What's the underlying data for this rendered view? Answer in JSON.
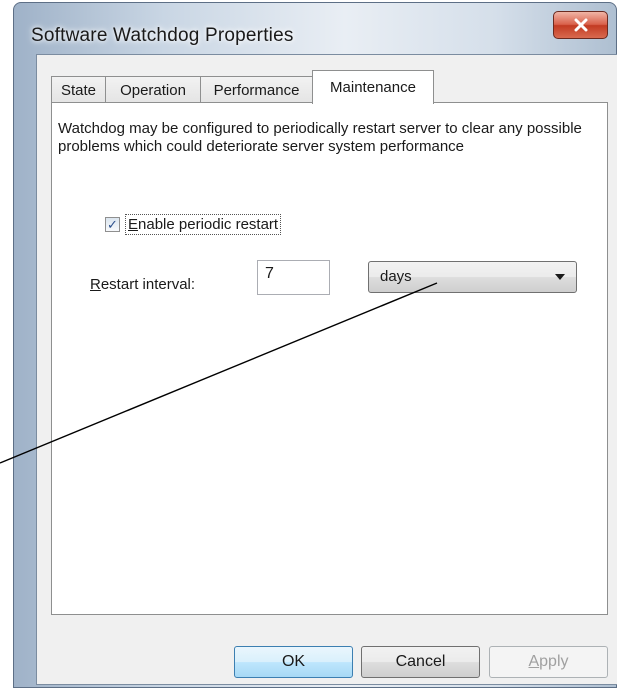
{
  "window": {
    "title": "Software Watchdog Properties",
    "close_glyph": "X"
  },
  "tabs": [
    {
      "label": "State",
      "active": false
    },
    {
      "label": "Operation",
      "active": false
    },
    {
      "label": "Performance",
      "active": false
    },
    {
      "label": "Maintenance",
      "active": true
    }
  ],
  "maintenance": {
    "description": "Watchdog may be configured to periodically restart server to clear any possible problems which could deteriorate server system performance",
    "enable_checkbox": {
      "checked": true,
      "check_glyph": "✓",
      "label_mnemonic": "E",
      "label_rest": "nable periodic restart"
    },
    "interval": {
      "label_mnemonic": "R",
      "label_rest": "estart interval:",
      "value": "7",
      "unit": "days"
    }
  },
  "buttons": {
    "ok": "OK",
    "cancel": "Cancel",
    "apply_mnemonic": "A",
    "apply_rest": "pply"
  }
}
